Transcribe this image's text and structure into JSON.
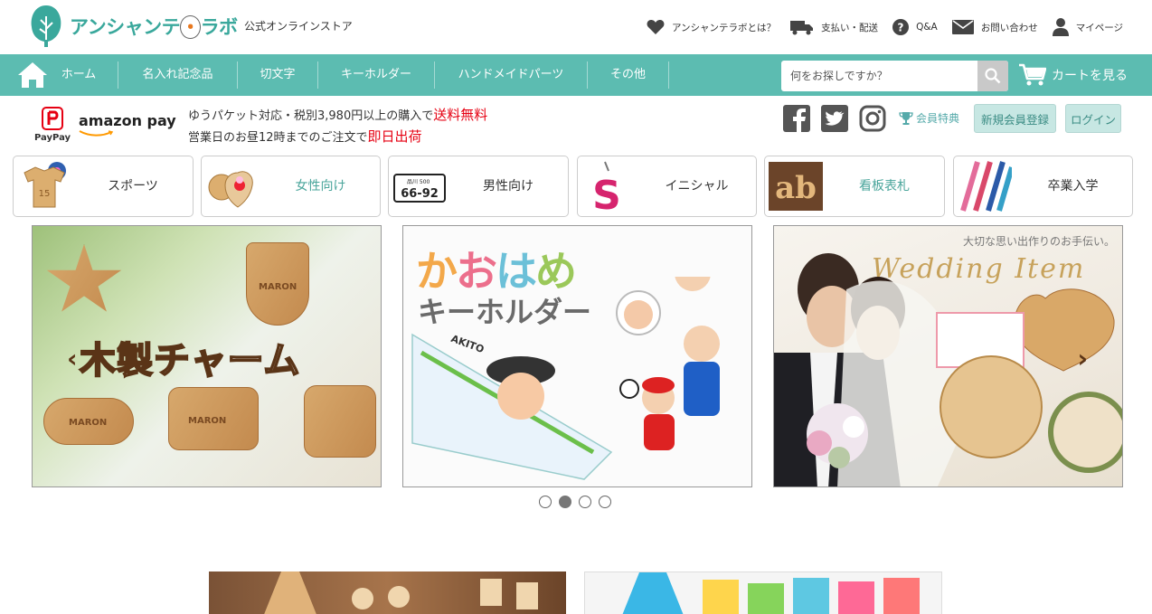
{
  "header": {
    "logo_name": "アンシャンテ",
    "logo_dot": "・",
    "logo_suffix": "ラボ",
    "tagline": "公式オンラインストア",
    "links": [
      {
        "icon": "heart-icon",
        "label": "アンシャンテラボとは？"
      },
      {
        "icon": "truck-icon",
        "label": "支払い・配送"
      },
      {
        "icon": "question-icon",
        "label": "Q&A"
      },
      {
        "icon": "mail-icon",
        "label": "お問い合わせ"
      },
      {
        "icon": "user-icon",
        "label": "マイページ"
      }
    ]
  },
  "navbar": {
    "items": [
      "ホーム",
      "名入れ記念品",
      "切文字",
      "キーホルダー",
      "ハンドメイドパーツ",
      "その他"
    ],
    "search_placeholder": "何をお探しですか？",
    "cart_label": "カートを見る"
  },
  "info": {
    "paypay_label": "PayPay",
    "amazon_label": "amazon pay",
    "ship_line1": "ゆうパケット対応・税別3,980円以上の購入で",
    "ship_free": "送料無料",
    "ship_line2": "営業日のお昼12時までのご注文で",
    "ship_same_day": "即日出荷",
    "member_benefit": "会員特典",
    "register_label": "新規会員登録",
    "login_label": "ログイン"
  },
  "categories": [
    {
      "label": "スポーツ",
      "thumb": "shirt-keychain"
    },
    {
      "label": "女性向け",
      "thumb": "wood-charm"
    },
    {
      "label": "男性向け",
      "thumb": "license-plate"
    },
    {
      "label": "イニシャル",
      "thumb": "letter-s"
    },
    {
      "label": "看板表札",
      "thumb": "ab-wood"
    },
    {
      "label": "卒業入学",
      "thumb": "pens"
    }
  ],
  "banners": [
    {
      "title": "木製チャーム",
      "tag": "MARON"
    },
    {
      "title_chars": [
        "か",
        "お",
        "は",
        "め"
      ],
      "subtitle": "キーホルダー",
      "name": "AKITO"
    },
    {
      "tag": "大切な思い出作りのお手伝い。",
      "title": "Wedding Item"
    }
  ],
  "carousel": {
    "count": 4,
    "active": 1
  },
  "colors": {
    "primary": "#5cbcb1",
    "accent_red": "#e60012",
    "brand_orange": "#e8781e"
  }
}
